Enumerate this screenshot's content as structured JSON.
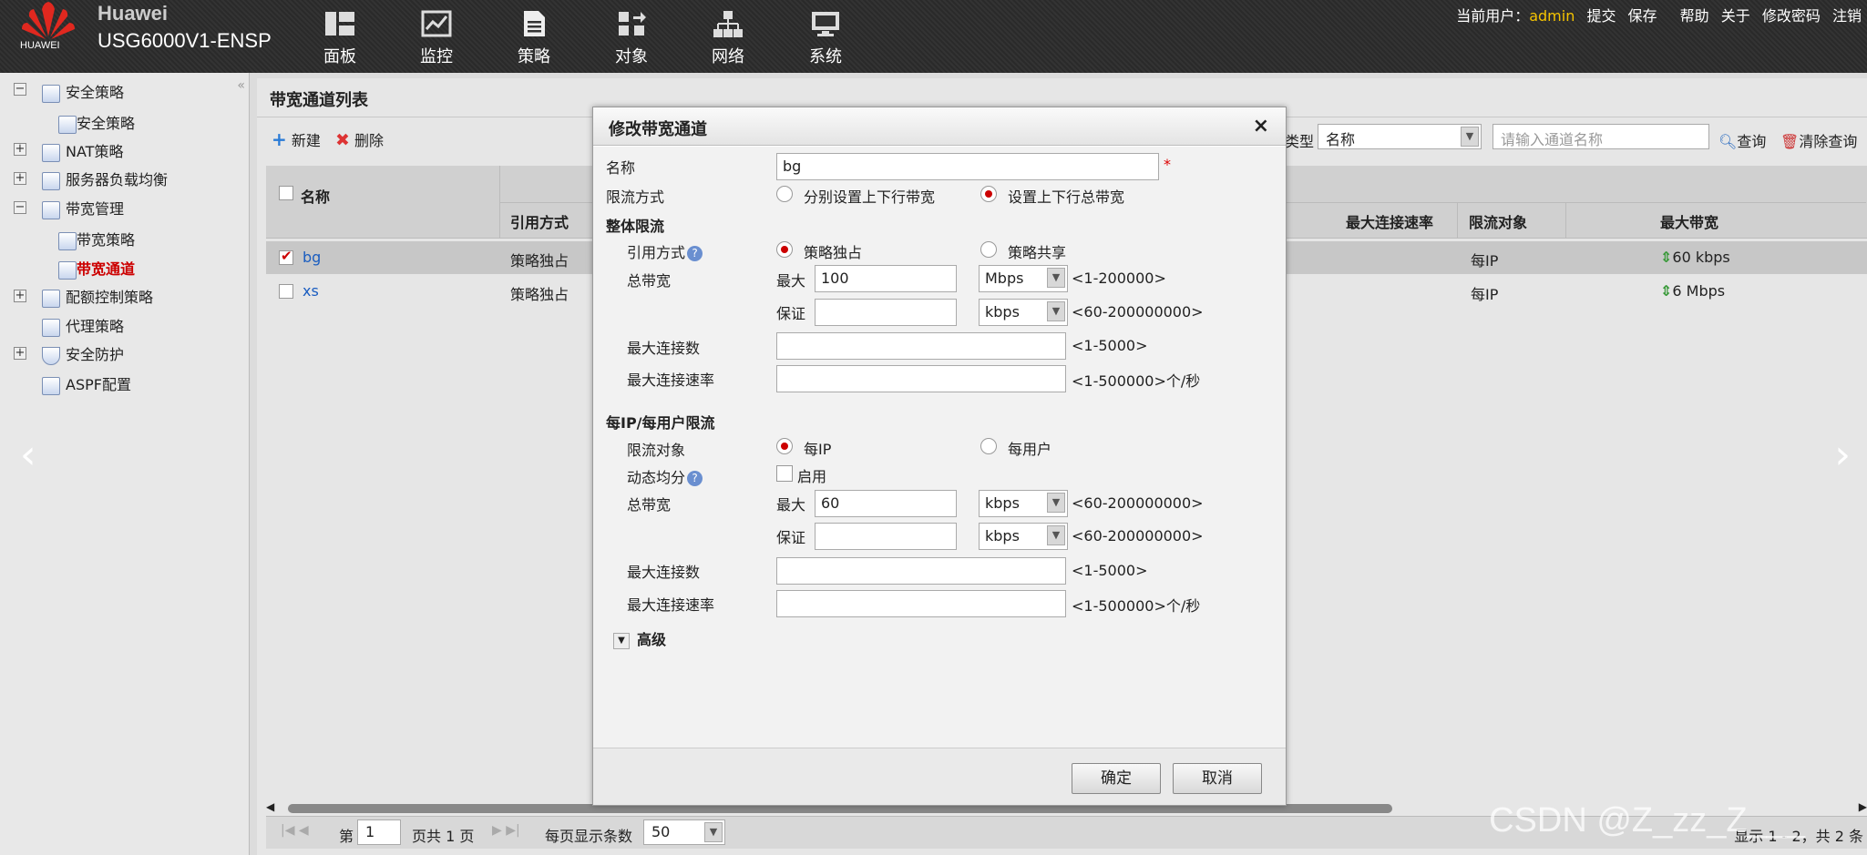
{
  "app": {
    "brand_top": "Huawei",
    "brand_bottom": "USG6000V1-ENSP",
    "logo_text": "HUAWEI"
  },
  "nav": [
    {
      "label": "面板",
      "icon": "dashboard-icon"
    },
    {
      "label": "监控",
      "icon": "monitor-icon"
    },
    {
      "label": "策略",
      "icon": "policy-icon"
    },
    {
      "label": "对象",
      "icon": "object-icon"
    },
    {
      "label": "网络",
      "icon": "network-icon"
    },
    {
      "label": "系统",
      "icon": "system-icon"
    }
  ],
  "userbar": {
    "current_user_label": "当前用户：",
    "user": "admin",
    "submit": "提交",
    "save": "保存",
    "help": "帮助",
    "about": "关于",
    "change_password": "修改密码",
    "logout": "注销"
  },
  "sidebar": {
    "items": [
      {
        "label": "安全策略"
      },
      {
        "label": "安全策略"
      },
      {
        "label": "NAT策略"
      },
      {
        "label": "服务器负载均衡"
      },
      {
        "label": "带宽管理"
      },
      {
        "label": "带宽策略"
      },
      {
        "label": "带宽通道"
      },
      {
        "label": "配额控制策略"
      },
      {
        "label": "代理策略"
      },
      {
        "label": "安全防护"
      },
      {
        "label": "ASPF配置"
      }
    ],
    "collapse_glyph": "«"
  },
  "list": {
    "title": "带宽通道列表",
    "new_label": "新建",
    "delete_label": "删除",
    "filter_type_label": "类型",
    "filter_type_value": "名称",
    "search_placeholder": "请输入通道名称",
    "query_label": "查询",
    "clear_label": "清除查询",
    "columns": {
      "name": "名称",
      "ref_mode": "引用方式",
      "max_conn_rate": "最大连接速率",
      "limit_target": "限流对象",
      "max_bw": "最大带宽"
    },
    "rows": [
      {
        "name": "bg",
        "ref_mode": "策略独占",
        "target": "每IP",
        "max_bw": "60 kbps",
        "checked": true
      },
      {
        "name": "xs",
        "ref_mode": "策略独占",
        "target": "每IP",
        "max_bw": "6 Mbps",
        "checked": false
      }
    ]
  },
  "pager": {
    "page_prefix": "第",
    "page": "1",
    "page_suffix": "页共 1 页",
    "per_page_label": "每页显示条数",
    "per_page": "50",
    "summary": "显示 1 - 2，共 2 条"
  },
  "dialog": {
    "title": "修改带宽通道",
    "close_glyph": "×",
    "name_label": "名称",
    "name_value": "bg",
    "required_mark": "*",
    "limit_mode_label": "限流方式",
    "limit_mode_opt1": "分别设置上下行带宽",
    "limit_mode_opt2": "设置上下行总带宽",
    "overall_section": "整体限流",
    "ref_mode_label": "引用方式",
    "ref_opt1": "策略独占",
    "ref_opt2": "策略共享",
    "total_bw_label": "总带宽",
    "max_label": "最大",
    "guarantee_label": "保证",
    "overall_max_value": "100",
    "overall_max_unit": "Mbps",
    "overall_max_hint": "<1-200000>",
    "overall_guar_unit": "kbps",
    "overall_guar_hint": "<60-200000000>",
    "max_conn_label": "最大连接数",
    "max_conn_hint": "<1-5000>",
    "max_conn_rate_label": "最大连接速率",
    "max_conn_rate_hint": "<1-500000>个/秒",
    "perip_section": "每IP/每用户限流",
    "target_label": "限流对象",
    "target_opt1": "每IP",
    "target_opt2": "每用户",
    "dynamic_label": "动态均分",
    "enable_label": "启用",
    "perip_max_value": "60",
    "perip_max_unit": "kbps",
    "perip_max_hint": "<60-200000000>",
    "perip_guar_unit": "kbps",
    "perip_guar_hint": "<60-200000000>",
    "advanced_label": "高级",
    "ok_label": "确定",
    "cancel_label": "取消",
    "help_glyph": "?"
  },
  "watermark": "CSDN @Z_zz_Z___"
}
